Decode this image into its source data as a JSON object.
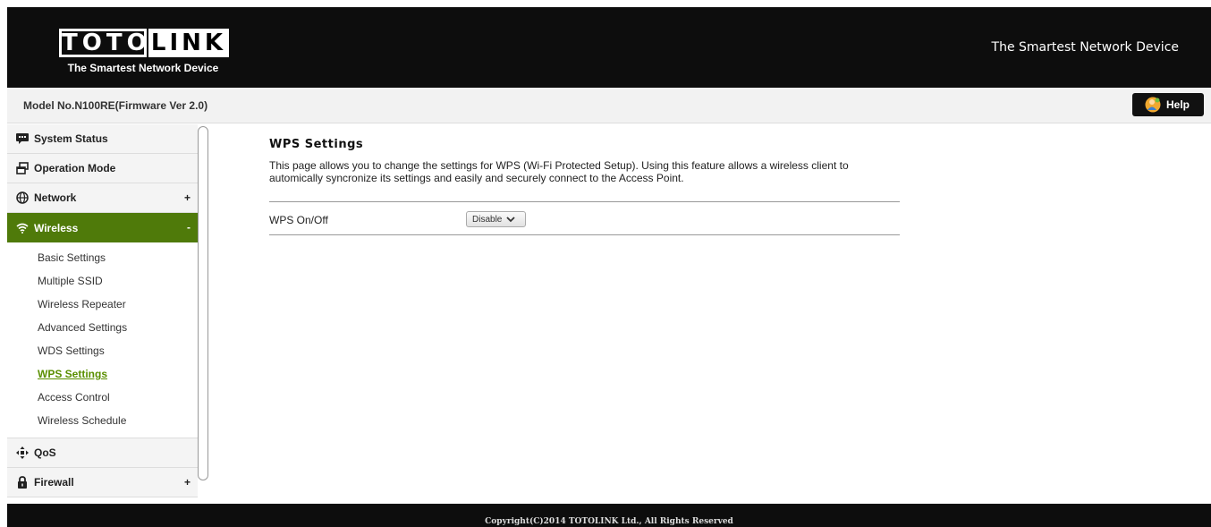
{
  "header": {
    "logo_left": "TOTO",
    "logo_right": "LINK",
    "logo_tagline": "The Smartest Network Device",
    "tagline": "The Smartest Network Device"
  },
  "modelbar": {
    "model_text": "Model No.N100RE(Firmware Ver 2.0)",
    "help_label": "Help"
  },
  "sidebar": {
    "items": [
      {
        "label": "System Status",
        "icon": "monitor-chat-icon",
        "sign": ""
      },
      {
        "label": "Operation Mode",
        "icon": "windows-icon",
        "sign": ""
      },
      {
        "label": "Network",
        "icon": "globe-icon",
        "sign": "+"
      },
      {
        "label": "Wireless",
        "icon": "wifi-icon",
        "sign": "-"
      },
      {
        "label": "QoS",
        "icon": "arrows-icon",
        "sign": ""
      },
      {
        "label": "Firewall",
        "icon": "lock-icon",
        "sign": "+"
      }
    ],
    "wireless_sub": [
      "Basic Settings",
      "Multiple SSID",
      "Wireless Repeater",
      "Advanced Settings",
      "WDS Settings",
      "WPS Settings",
      "Access Control",
      "Wireless Schedule"
    ],
    "current_sub": "WPS Settings"
  },
  "main": {
    "title": "WPS Settings",
    "description": "This page allows you to change the settings for WPS (Wi-Fi Protected Setup). Using this feature allows a wireless client to automically syncronize its settings and easily and securely connect to the Access Point.",
    "wps_label": "WPS On/Off",
    "wps_value": "Disable"
  },
  "footer": {
    "copyright": "Copyright(C)2014 TOTOLINK Ltd., All Rights Reserved"
  },
  "colors": {
    "accent": "#4f7a0a",
    "link_active": "#5a8f00",
    "header_bg": "#0d0d0d"
  }
}
